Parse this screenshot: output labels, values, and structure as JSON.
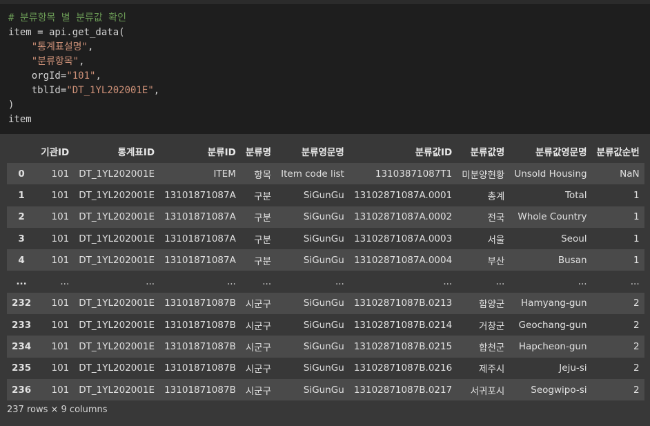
{
  "code": {
    "line1": "# 분류항목 별 분류값 확인",
    "line2_var": "item",
    "line2_rest": " = api.get_data(",
    "line3": "\"통계표설명\"",
    "line4": "\"분류항목\"",
    "line5_key": "orgId",
    "line5_val": "\"101\"",
    "line6_key": "tblId",
    "line6_val": "\"DT_1YL202001E\"",
    "line7": ")",
    "line8": "item"
  },
  "table": {
    "columns": [
      "",
      "기관ID",
      "통계표ID",
      "분류ID",
      "분류명",
      "분류영문명",
      "분류값ID",
      "분류값명",
      "분류값영문명",
      "분류값순번"
    ],
    "rows": [
      [
        "0",
        "101",
        "DT_1YL202001E",
        "ITEM",
        "항목",
        "Item code list",
        "13103871087T1",
        "미분양현황",
        "Unsold Housing",
        "NaN"
      ],
      [
        "1",
        "101",
        "DT_1YL202001E",
        "13101871087A",
        "구분",
        "SiGunGu",
        "13102871087A.0001",
        "총계",
        "Total",
        "1"
      ],
      [
        "2",
        "101",
        "DT_1YL202001E",
        "13101871087A",
        "구분",
        "SiGunGu",
        "13102871087A.0002",
        "전국",
        "Whole Country",
        "1"
      ],
      [
        "3",
        "101",
        "DT_1YL202001E",
        "13101871087A",
        "구분",
        "SiGunGu",
        "13102871087A.0003",
        "서울",
        "Seoul",
        "1"
      ],
      [
        "4",
        "101",
        "DT_1YL202001E",
        "13101871087A",
        "구분",
        "SiGunGu",
        "13102871087A.0004",
        "부산",
        "Busan",
        "1"
      ],
      [
        "...",
        "...",
        "...",
        "...",
        "...",
        "...",
        "...",
        "...",
        "...",
        "..."
      ],
      [
        "232",
        "101",
        "DT_1YL202001E",
        "13101871087B",
        "시군구",
        "SiGunGu",
        "13102871087B.0213",
        "함양군",
        "Hamyang-gun",
        "2"
      ],
      [
        "233",
        "101",
        "DT_1YL202001E",
        "13101871087B",
        "시군구",
        "SiGunGu",
        "13102871087B.0214",
        "거창군",
        "Geochang-gun",
        "2"
      ],
      [
        "234",
        "101",
        "DT_1YL202001E",
        "13101871087B",
        "시군구",
        "SiGunGu",
        "13102871087B.0215",
        "합천군",
        "Hapcheon-gun",
        "2"
      ],
      [
        "235",
        "101",
        "DT_1YL202001E",
        "13101871087B",
        "시군구",
        "SiGunGu",
        "13102871087B.0216",
        "제주시",
        "Jeju-si",
        "2"
      ],
      [
        "236",
        "101",
        "DT_1YL202001E",
        "13101871087B",
        "시군구",
        "SiGunGu",
        "13102871087B.0217",
        "서귀포시",
        "Seogwipo-si",
        "2"
      ]
    ],
    "footer": "237 rows × 9 columns"
  },
  "colors": {
    "editor_bg": "#1e1e1e",
    "output_bg": "#383838",
    "stripe": "#4a4a4a",
    "comment": "#6a9955",
    "string": "#ce9178"
  }
}
